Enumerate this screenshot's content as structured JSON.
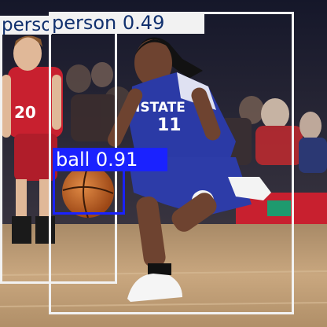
{
  "detections": [
    {
      "label": "person",
      "score": "0.49",
      "box_color": "#f2f2f2",
      "label_bg": "#f2f2f2",
      "label_color": "#10306e",
      "label_text": "person"
    },
    {
      "label": "person",
      "score": "0.49",
      "box_color": "#f2f2f2",
      "label_bg": "#f2f2f2",
      "label_color": "#10306e",
      "label_text": "person 0.49"
    },
    {
      "label": "ball",
      "score": "0.91",
      "box_color": "#1a22ff",
      "label_bg": "#1a22ff",
      "label_color": "#ffffff",
      "label_text": "ball 0.91"
    }
  ],
  "colors": {
    "court": "#c9a77f",
    "jersey_blue": "#2b3aa6",
    "jersey_red": "#c8202f",
    "ball": "#c6621f"
  }
}
